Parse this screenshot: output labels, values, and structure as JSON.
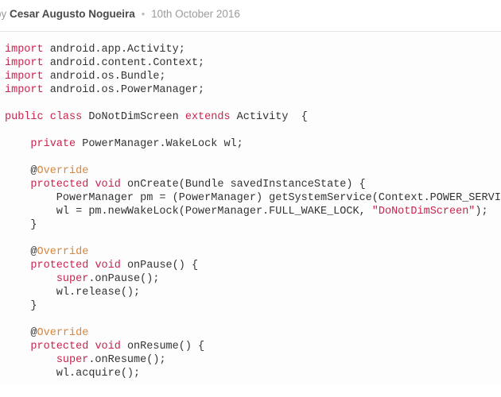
{
  "meta": {
    "by": "by ",
    "author": "Cesar Augusto Nogueira",
    "sep": "•",
    "date": "10th October 2016"
  },
  "code": {
    "t": {
      "import": "import",
      "public": "public",
      "class": "class",
      "extends": "extends",
      "private": "private",
      "protected": "protected",
      "void": "void",
      "super": "super",
      "at": "@",
      "override": "Override"
    },
    "l1": " android.app.Activity;",
    "l2": " android.content.Context;",
    "l3": " android.os.Bundle;",
    "l4": " android.os.PowerManager;",
    "l6a": " DoNotDimScreen ",
    "l6b": " Activity  {",
    "l8": " PowerManager.WakeLock wl;",
    "l11a": " onCreate(Bundle savedInstanceState) {",
    "l12": "        PowerManager pm = (PowerManager) getSystemService(Context.POWER_SERVICE);",
    "l13a": "        wl = pm.newWakeLock(PowerManager.FULL_WAKE_LOCK, ",
    "l13s": "\"DoNotDimScreen\"",
    "l13b": ");",
    "l14": "    }",
    "l17a": " onPause() {",
    "l18": ".onPause();",
    "l19": "        wl.release();",
    "l20": "    }",
    "l23a": " onResume() {",
    "l24": ".onResume();",
    "l25": "        wl.acquire();",
    "sp4": "    ",
    "sp8": "        "
  }
}
